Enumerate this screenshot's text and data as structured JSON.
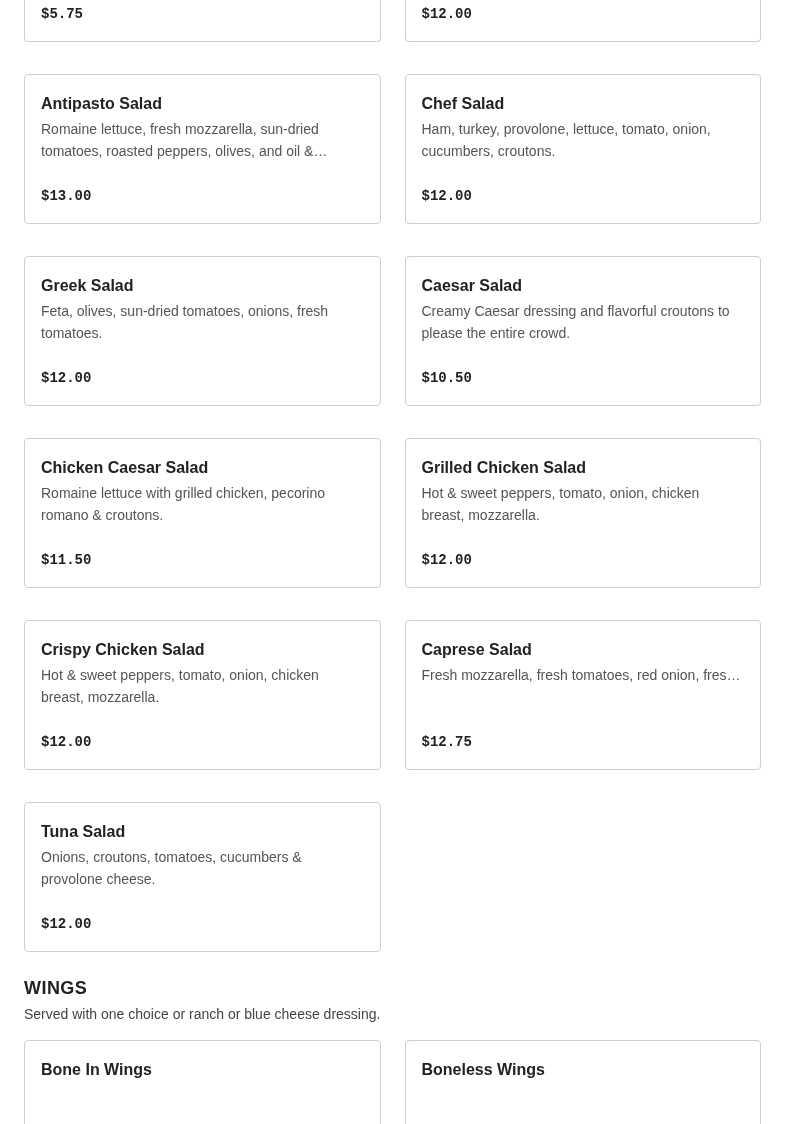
{
  "top_row": [
    {
      "price": "$5.75"
    },
    {
      "price": "$12.00"
    }
  ],
  "salads": [
    {
      "name": "Antipasto Salad",
      "description": "Romaine lettuce, fresh mozzarella, sun-dried tomatoes, roasted peppers, olives, and oil &…",
      "price": "$13.00"
    },
    {
      "name": "Chef Salad",
      "description": "Ham, turkey, provolone, lettuce, tomato, onion, cucumbers, croutons.",
      "price": "$12.00"
    },
    {
      "name": "Greek Salad",
      "description": "Feta, olives, sun-dried tomatoes, onions, fresh tomatoes.",
      "price": "$12.00"
    },
    {
      "name": "Caesar Salad",
      "description": "Creamy Caesar dressing and flavorful croutons to please the entire crowd.",
      "price": "$10.50"
    },
    {
      "name": "Chicken Caesar Salad",
      "description": "Romaine lettuce with grilled chicken, pecorino romano & croutons.",
      "price": "$11.50"
    },
    {
      "name": "Grilled Chicken Salad",
      "description": "Hot & sweet peppers, tomato, onion, chicken breast, mozzarella.",
      "price": "$12.00"
    },
    {
      "name": "Crispy Chicken Salad",
      "description": "Hot & sweet peppers, tomato, onion, chicken breast, mozzarella.",
      "price": "$12.00"
    },
    {
      "name": "Caprese Salad",
      "description": "Fresh mozzarella, fresh tomatoes, red onion, fres…",
      "price": "$12.75"
    },
    {
      "name": "Tuna Salad",
      "description": "Onions, croutons, tomatoes, cucumbers & provolone cheese.",
      "price": "$12.00"
    }
  ],
  "wings": {
    "heading": "WINGS",
    "description": "Served with one choice or ranch or blue cheese dressing.",
    "items": [
      {
        "name": "Bone In Wings"
      },
      {
        "name": "Boneless Wings"
      }
    ]
  }
}
